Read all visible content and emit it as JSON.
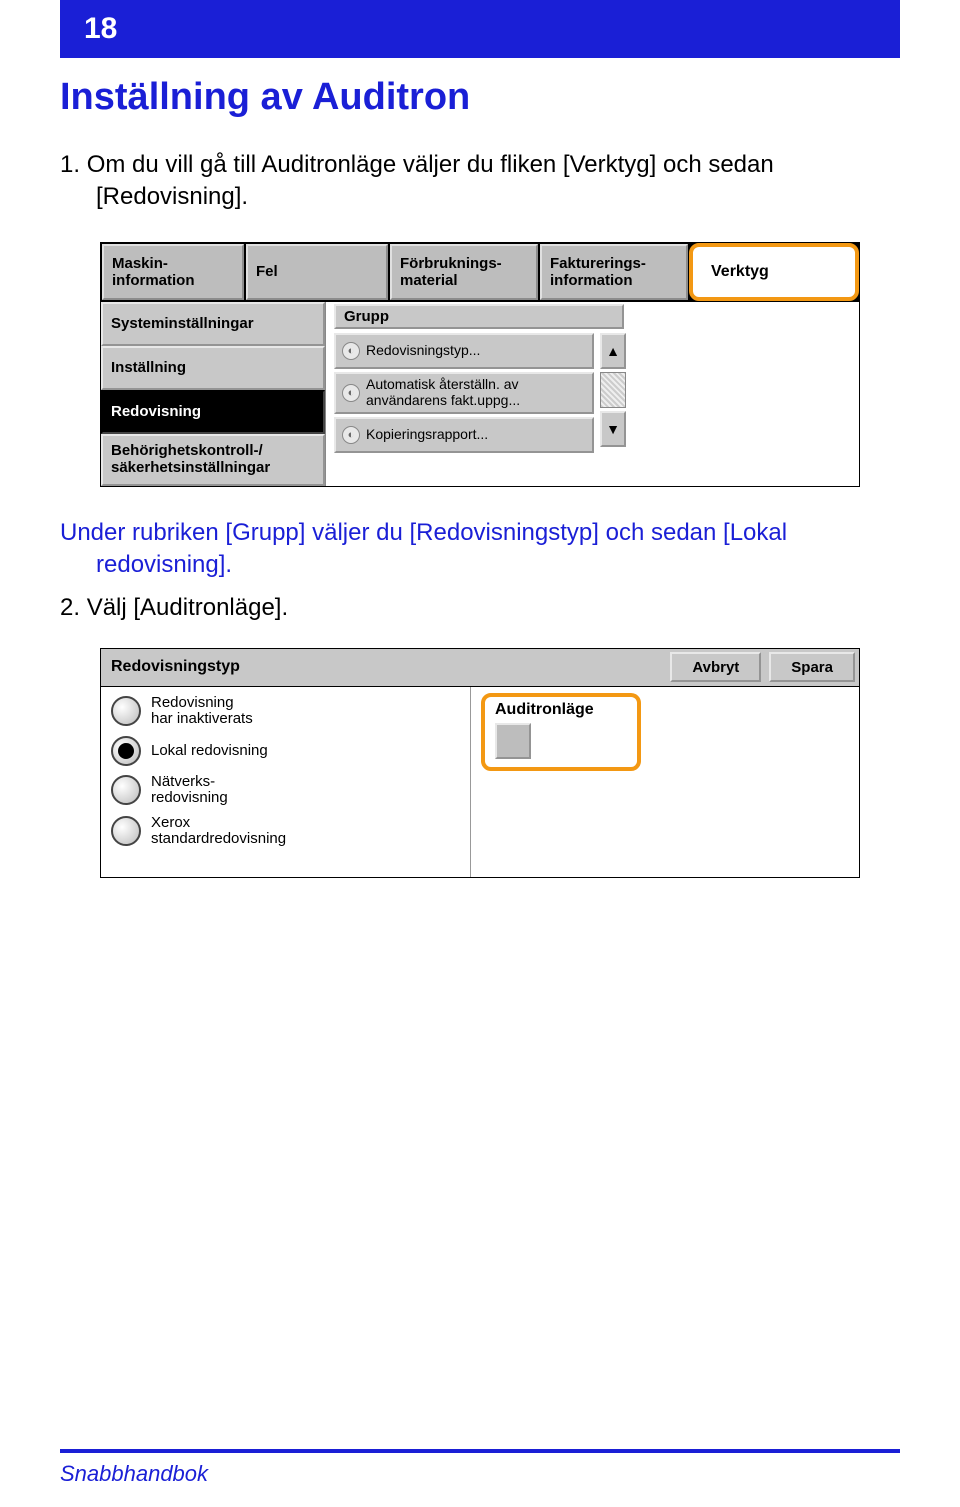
{
  "page_number": "18",
  "title": "Inställning av Auditron",
  "para1_prefix": "1. ",
  "para1": "Om du vill gå till Auditronläge väljer du fliken [Verktyg] och sedan [Redovisning].",
  "para2": "Under rubriken [Grupp] väljer du [Redovisningstyp] och sedan [Lokal redovisning].",
  "para3_prefix": "2. ",
  "para3": "Välj [Auditronläge].",
  "footer": "Snabbhandbok",
  "shot1": {
    "tabs": [
      "Maskin-\ninformation",
      "Fel",
      "Förbruknings-\nmaterial",
      "Fakturerings-\ninformation",
      "Verktyg"
    ],
    "sidebar": [
      "Systeminställningar",
      "Inställning",
      "Redovisning",
      "Behörighetskontroll-/\nsäkerhetsinställningar"
    ],
    "group_label": "Grupp",
    "group_items": [
      "Redovisningstyp...",
      "Automatisk återställn. av\nanvändarens fakt.uppg...",
      "Kopieringsrapport..."
    ]
  },
  "shot2": {
    "title": "Redovisningstyp",
    "buttons": [
      "Avbryt",
      "Spara"
    ],
    "radios": [
      "Redovisning\nhar inaktiverats",
      "Lokal redovisning",
      "Nätverks-\nredovisning",
      "Xerox\nstandardredovisning"
    ],
    "selected_index": 1,
    "auditron_label": "Auditronläge"
  }
}
